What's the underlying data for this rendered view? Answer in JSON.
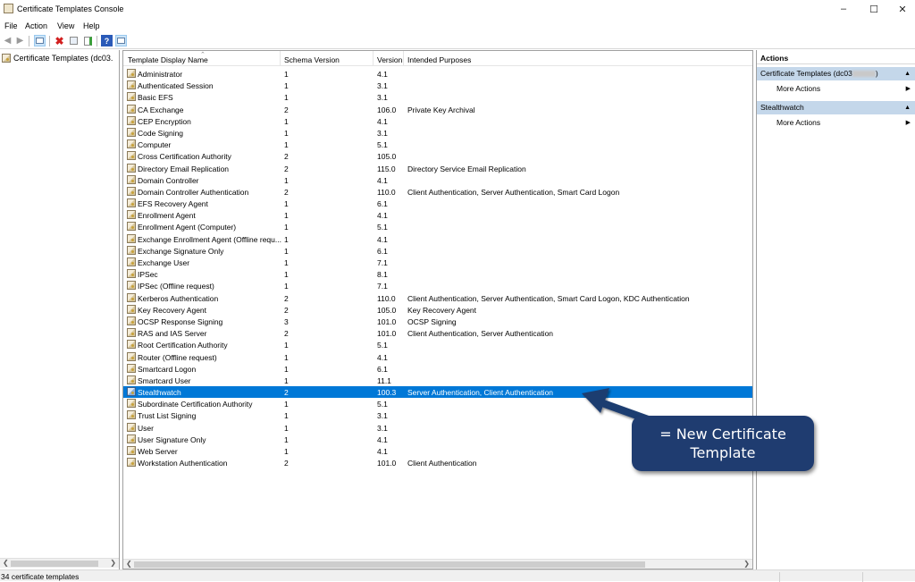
{
  "window": {
    "title": "Certificate Templates Console"
  },
  "menu": [
    "File",
    "Action",
    "View",
    "Help"
  ],
  "toolbar": {
    "icons": [
      "back-icon",
      "forward-icon",
      "show-hide-tree-icon",
      "delete-icon",
      "properties-icon",
      "export-list-icon",
      "help-icon",
      "show-hide-action-pane-icon"
    ]
  },
  "tree": {
    "root_label": "Certificate Templates (dc03."
  },
  "list": {
    "columns": [
      "Template Display Name",
      "Schema Version",
      "Version",
      "Intended Purposes"
    ],
    "rows": [
      {
        "name": "Administrator",
        "schema": "1",
        "version": "4.1",
        "purposes": ""
      },
      {
        "name": "Authenticated Session",
        "schema": "1",
        "version": "3.1",
        "purposes": ""
      },
      {
        "name": "Basic EFS",
        "schema": "1",
        "version": "3.1",
        "purposes": ""
      },
      {
        "name": "CA Exchange",
        "schema": "2",
        "version": "106.0",
        "purposes": "Private Key Archival"
      },
      {
        "name": "CEP Encryption",
        "schema": "1",
        "version": "4.1",
        "purposes": ""
      },
      {
        "name": "Code Signing",
        "schema": "1",
        "version": "3.1",
        "purposes": ""
      },
      {
        "name": "Computer",
        "schema": "1",
        "version": "5.1",
        "purposes": ""
      },
      {
        "name": "Cross Certification Authority",
        "schema": "2",
        "version": "105.0",
        "purposes": ""
      },
      {
        "name": "Directory Email Replication",
        "schema": "2",
        "version": "115.0",
        "purposes": "Directory Service Email Replication"
      },
      {
        "name": "Domain Controller",
        "schema": "1",
        "version": "4.1",
        "purposes": ""
      },
      {
        "name": "Domain Controller Authentication",
        "schema": "2",
        "version": "110.0",
        "purposes": "Client Authentication, Server Authentication, Smart Card Logon"
      },
      {
        "name": "EFS Recovery Agent",
        "schema": "1",
        "version": "6.1",
        "purposes": ""
      },
      {
        "name": "Enrollment Agent",
        "schema": "1",
        "version": "4.1",
        "purposes": ""
      },
      {
        "name": "Enrollment Agent (Computer)",
        "schema": "1",
        "version": "5.1",
        "purposes": ""
      },
      {
        "name": "Exchange Enrollment Agent (Offline requ...",
        "schema": "1",
        "version": "4.1",
        "purposes": ""
      },
      {
        "name": "Exchange Signature Only",
        "schema": "1",
        "version": "6.1",
        "purposes": ""
      },
      {
        "name": "Exchange User",
        "schema": "1",
        "version": "7.1",
        "purposes": ""
      },
      {
        "name": "IPSec",
        "schema": "1",
        "version": "8.1",
        "purposes": ""
      },
      {
        "name": "IPSec (Offline request)",
        "schema": "1",
        "version": "7.1",
        "purposes": ""
      },
      {
        "name": "Kerberos Authentication",
        "schema": "2",
        "version": "110.0",
        "purposes": "Client Authentication, Server Authentication, Smart Card Logon, KDC Authentication"
      },
      {
        "name": "Key Recovery Agent",
        "schema": "2",
        "version": "105.0",
        "purposes": "Key Recovery Agent"
      },
      {
        "name": "OCSP Response Signing",
        "schema": "3",
        "version": "101.0",
        "purposes": "OCSP Signing"
      },
      {
        "name": "RAS and IAS Server",
        "schema": "2",
        "version": "101.0",
        "purposes": "Client Authentication, Server Authentication"
      },
      {
        "name": "Root Certification Authority",
        "schema": "1",
        "version": "5.1",
        "purposes": ""
      },
      {
        "name": "Router (Offline request)",
        "schema": "1",
        "version": "4.1",
        "purposes": ""
      },
      {
        "name": "Smartcard Logon",
        "schema": "1",
        "version": "6.1",
        "purposes": ""
      },
      {
        "name": "Smartcard User",
        "schema": "1",
        "version": "11.1",
        "purposes": ""
      },
      {
        "name": "Stealthwatch",
        "schema": "2",
        "version": "100.3",
        "purposes": "Server Authentication, Client Authentication",
        "selected": true
      },
      {
        "name": "Subordinate Certification Authority",
        "schema": "1",
        "version": "5.1",
        "purposes": ""
      },
      {
        "name": "Trust List Signing",
        "schema": "1",
        "version": "3.1",
        "purposes": ""
      },
      {
        "name": "User",
        "schema": "1",
        "version": "3.1",
        "purposes": ""
      },
      {
        "name": "User Signature Only",
        "schema": "1",
        "version": "4.1",
        "purposes": ""
      },
      {
        "name": "Web Server",
        "schema": "1",
        "version": "4.1",
        "purposes": ""
      },
      {
        "name": "Workstation Authentication",
        "schema": "2",
        "version": "101.0",
        "purposes": "Client Authentication"
      }
    ]
  },
  "actions": {
    "header": "Actions",
    "sections": [
      {
        "title": "Certificate Templates (dc03",
        "title_suffix": ")",
        "item": "More Actions"
      },
      {
        "title": "Stealthwatch",
        "title_suffix": "",
        "item": "More Actions"
      }
    ]
  },
  "status": {
    "text": "34 certificate templates"
  },
  "annotation": {
    "line1": "= New Certificate",
    "line2": "Template",
    "color": "#1f3c70"
  },
  "colors": {
    "selection": "#0078d7",
    "action_section": "#c4d7ea"
  }
}
